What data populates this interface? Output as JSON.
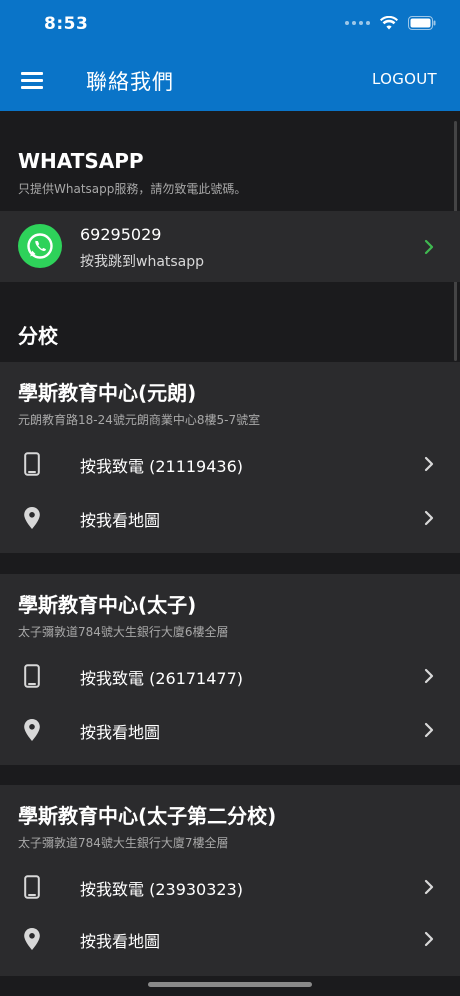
{
  "status_bar": {
    "time": "8:53"
  },
  "header": {
    "title": "聯絡我們",
    "logout_label": "LOGOUT",
    "menu_icon": "hamburger-menu-icon"
  },
  "whatsapp": {
    "title": "WHATSAPP",
    "subtitle": "只提供Whatsapp服務，請勿致電此號碼。",
    "number": "69295029",
    "action": "按我跳到whatsapp",
    "icon": "whatsapp-icon"
  },
  "branches": {
    "section_title": "分校",
    "items": [
      {
        "name": "學斯教育中心(元朗)",
        "address": "元朗教育路18-24號元朗商業中心8樓5-7號室",
        "call_label": "按我致電 (21119436)",
        "map_label": "按我看地圖"
      },
      {
        "name": "學斯教育中心(太子)",
        "address": "太子彌敦道784號大生銀行大廈6樓全層",
        "call_label": "按我致電 (26171477)",
        "map_label": "按我看地圖"
      },
      {
        "name": "學斯教育中心(太子第二分校)",
        "address": "太子彌敦道784號大生銀行大廈7樓全層",
        "call_label": "按我致電 (23930323)",
        "map_label": "按我看地圖"
      }
    ]
  },
  "colors": {
    "app_bar": "#0a74c8",
    "background": "#1b1b1d",
    "card": "#2b2b2d",
    "whatsapp_green": "#2ed25a",
    "chevron_green": "#3fb950"
  }
}
